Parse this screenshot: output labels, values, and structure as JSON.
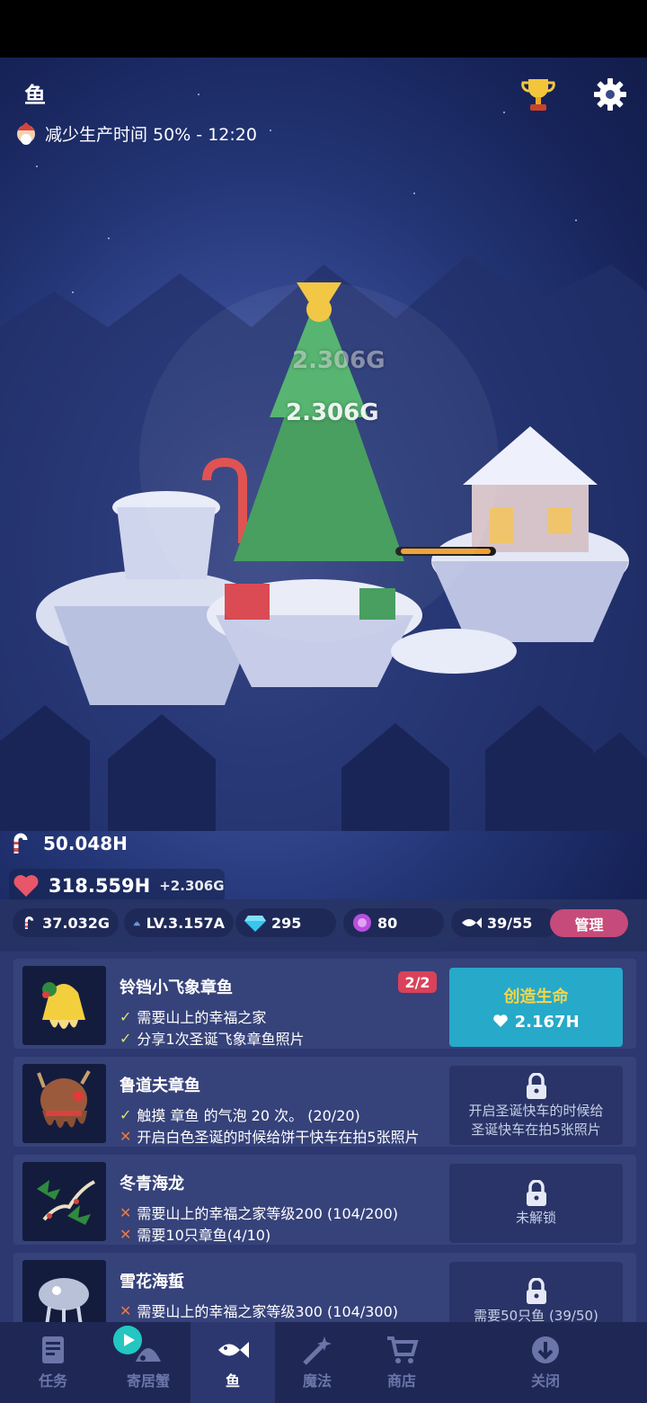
{
  "header": {
    "title": "鱼",
    "boost_text": "减少生产时间 50% - 12:20"
  },
  "scene": {
    "float_value_1": "2.306G",
    "float_value_2": "2.306G"
  },
  "resources": {
    "candy_total": "50.048H",
    "hearts": "318.559H",
    "hearts_rate": "+2.306G",
    "candy": "37.032G",
    "level": "LV.3.157A",
    "gems": "295",
    "orbs": "80",
    "fish_count": "39/55",
    "manage_label": "管理"
  },
  "cards": [
    {
      "name": "铃铛小飞象章鱼",
      "badge": "2/2",
      "requirements": [
        {
          "status": "done",
          "text": "需要山上的幸福之家"
        },
        {
          "status": "done",
          "text": "分享1次圣诞飞象章鱼照片"
        }
      ],
      "action_title": "创造生命",
      "action_cost": "2.167H"
    },
    {
      "name": "鲁道夫章鱼",
      "requirements": [
        {
          "status": "done",
          "text": "触摸 章鱼 的气泡 20 次。 (20/20)"
        },
        {
          "status": "todo",
          "text": "开启白色圣诞的时候给饼干快车在拍5张照片"
        }
      ],
      "lock_text_1": "开启圣诞快车的时候给",
      "lock_text_2": "圣诞快车在拍5张照片"
    },
    {
      "name": "冬青海龙",
      "requirements": [
        {
          "status": "todo",
          "text": "需要山上的幸福之家等级200 (104/200)"
        },
        {
          "status": "todo",
          "text": "需要10只章鱼(4/10)"
        }
      ],
      "lock_text_1": "未解锁"
    },
    {
      "name": "雪花海蜇",
      "requirements": [
        {
          "status": "todo",
          "text": "需要山上的幸福之家等级300 (104/300)"
        }
      ],
      "lock_text_1": "需要50只鱼 (39/50)"
    }
  ],
  "nav": [
    {
      "label": "任务",
      "icon": "quest-icon"
    },
    {
      "label": "寄居蟹",
      "icon": "hermit-crab-icon"
    },
    {
      "label": "鱼",
      "icon": "fish-icon"
    },
    {
      "label": "魔法",
      "icon": "magic-icon"
    },
    {
      "label": "商店",
      "icon": "cart-icon"
    },
    {
      "label": "关闭",
      "icon": "close-down-icon"
    }
  ]
}
